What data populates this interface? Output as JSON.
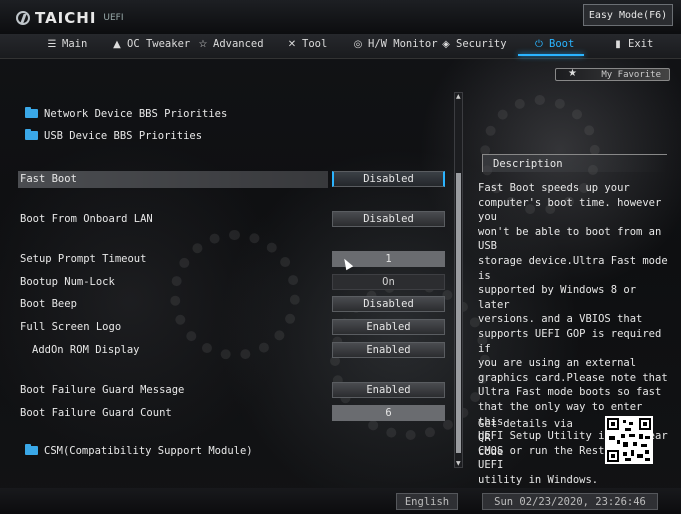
{
  "header": {
    "logo_text": "TAICHI",
    "logo_sub": "UEFI",
    "easy_mode": "Easy Mode(F6)"
  },
  "menu": [
    {
      "label": "Main",
      "icon": "list-icon"
    },
    {
      "label": "OC Tweaker",
      "icon": "rocket-icon"
    },
    {
      "label": "Advanced",
      "icon": "star-icon"
    },
    {
      "label": "Tool",
      "icon": "tools-icon"
    },
    {
      "label": "H/W Monitor",
      "icon": "monitor-icon"
    },
    {
      "label": "Security",
      "icon": "shield-icon"
    },
    {
      "label": "Boot",
      "icon": "power-icon",
      "active": true
    },
    {
      "label": "Exit",
      "icon": "exit-icon"
    }
  ],
  "favorite": "My Favorite",
  "folders": {
    "network": "Network Device BBS Priorities",
    "usb": "USB Device BBS Priorities",
    "csm": "CSM(Compatibility Support Module)"
  },
  "settings": {
    "fast_boot": {
      "label": "Fast Boot",
      "value": "Disabled"
    },
    "onboard_lan": {
      "label": "Boot From Onboard LAN",
      "value": "Disabled"
    },
    "setup_prompt": {
      "label": "Setup Prompt Timeout",
      "value": "1"
    },
    "numlock": {
      "label": "Bootup Num-Lock",
      "value": "On"
    },
    "beep": {
      "label": "Boot Beep",
      "value": "Disabled"
    },
    "full_logo": {
      "label": "Full Screen Logo",
      "value": "Enabled"
    },
    "addon_rom": {
      "label": "AddOn ROM Display",
      "value": "Enabled"
    },
    "guard_msg": {
      "label": "Boot Failure Guard Message",
      "value": "Enabled"
    },
    "guard_count": {
      "label": "Boot Failure Guard Count",
      "value": "6"
    }
  },
  "description": {
    "title": "Description",
    "text": "Fast Boot speeds up your\ncomputer's boot time. however you\nwon't be able to boot from an USB\nstorage device.Ultra Fast mode is\nsupported by Windows 8 or later\nversions. and a VBIOS that\nsupports UEFI GOP is required if\nyou are using an external\ngraphics card.Please note that\nUltra Fast mode boots so fast\nthat the only way to enter this\nUEFI Setup Utility is to clear\nCMOS or run the Restart to UEFI\nutility in Windows.",
    "qr_text": "Get details via QR\ncode"
  },
  "footer": {
    "language": "English",
    "datetime": "Sun 02/23/2020, 23:26:46"
  },
  "colors": {
    "accent": "#2ab4ff",
    "folder": "#3aa8e8"
  }
}
